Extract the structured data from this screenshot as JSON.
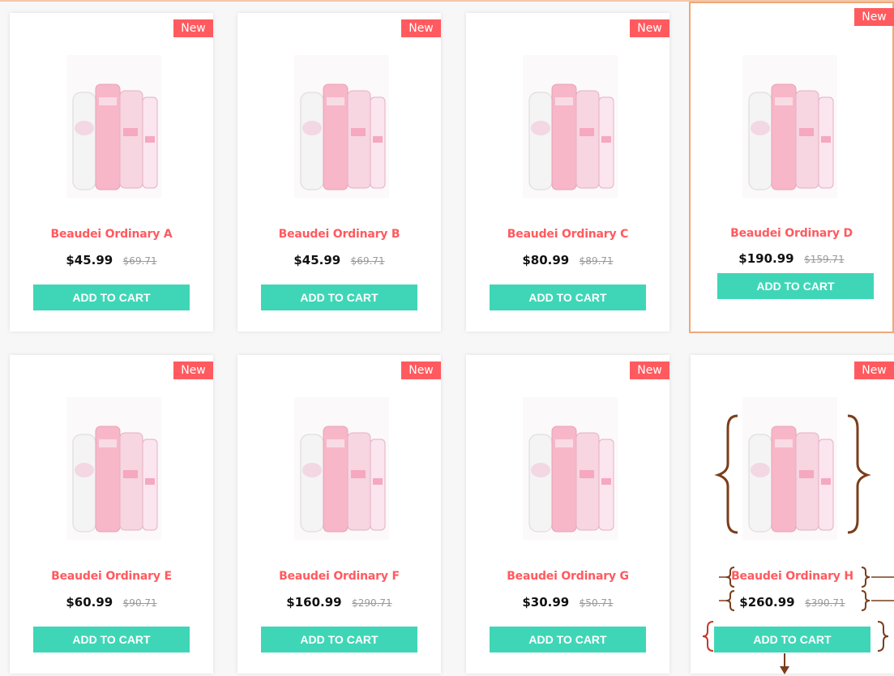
{
  "products": [
    {
      "badge": "New",
      "title": "Beaudei Ordinary A",
      "price": "$45.99",
      "old_price": "$69.71",
      "button": "ADD TO CART"
    },
    {
      "badge": "New",
      "title": "Beaudei Ordinary B",
      "price": "$45.99",
      "old_price": "$69.71",
      "button": "ADD TO CART"
    },
    {
      "badge": "New",
      "title": "Beaudei Ordinary C",
      "price": "$80.99",
      "old_price": "$89.71",
      "button": "ADD TO CART"
    },
    {
      "badge": "New",
      "title": "Beaudei Ordinary D",
      "price": "$190.99",
      "old_price": "$159.71",
      "button": "ADD TO CART"
    },
    {
      "badge": "New",
      "title": "Beaudei Ordinary E",
      "price": "$60.99",
      "old_price": "$90.71",
      "button": "ADD TO CART"
    },
    {
      "badge": "New",
      "title": "Beaudei Ordinary F",
      "price": "$160.99",
      "old_price": "$290.71",
      "button": "ADD TO CART"
    },
    {
      "badge": "New",
      "title": "Beaudei Ordinary G",
      "price": "$30.99",
      "old_price": "$50.71",
      "button": "ADD TO CART"
    },
    {
      "badge": "New",
      "title": "Beaudei Ordinary H",
      "price": "$260.99",
      "old_price": "$390.71",
      "button": "ADD TO CART"
    }
  ],
  "colors": {
    "accent_red": "#ff5a5f",
    "button_teal": "#3fd6b7",
    "active_border": "#f0a878",
    "annotation": "#7a3e1a"
  },
  "icons": {
    "product_image": "skincare-products-image",
    "annotation_brace": "curly-brace-icon",
    "annotation_arrow": "down-arrow-icon"
  }
}
